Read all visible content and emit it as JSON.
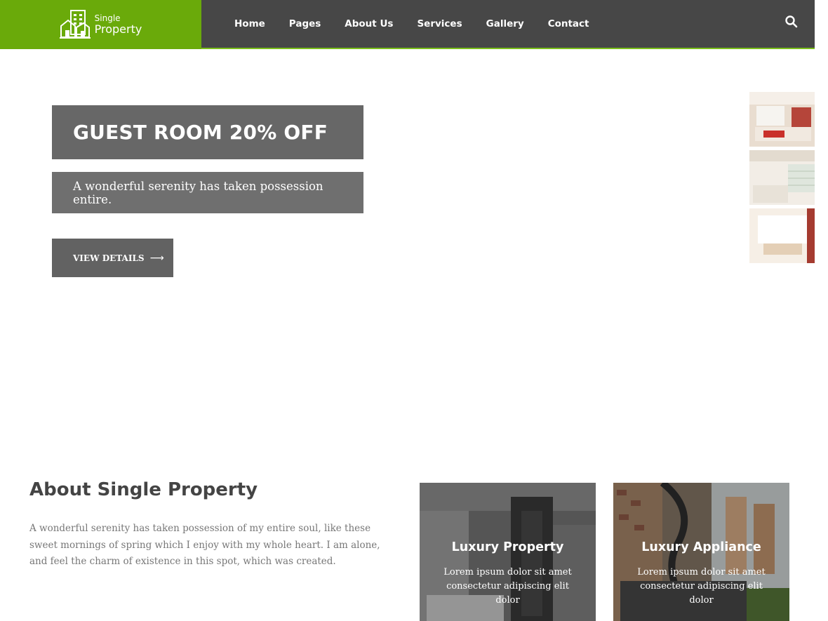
{
  "brand": {
    "small": "Single",
    "big": "Property",
    "accent_color": "#6aaa0a",
    "icon": "house-buildings-icon"
  },
  "nav": {
    "items": [
      "Home",
      "Pages",
      "About Us",
      "Services",
      "Gallery",
      "Contact"
    ],
    "search_icon": "search-icon"
  },
  "hero": {
    "title": "GUEST ROOM 20% OFF",
    "subtitle": "A wonderful serenity has taken possession entire.",
    "button_label": "VIEW DETAILS",
    "button_icon": "arrow-right-icon",
    "thumbnails": [
      "living-room-thumbnail",
      "kitchen-thumbnail",
      "lounge-thumbnail"
    ]
  },
  "about": {
    "title": "About Single Property",
    "text": "A wonderful serenity has taken possession of my entire soul, like these sweet mornings of spring which I enjoy with my whole heart. I am alone, and feel the charm of existence in this spot, which was created."
  },
  "cards": [
    {
      "title": "Luxury Property",
      "desc": "Lorem ipsum dolor sit amet consectetur adipiscing elit dolor"
    },
    {
      "title": "Luxury Appliance",
      "desc": "Lorem ipsum dolor sit amet consectetur adipiscing elit dolor"
    }
  ]
}
